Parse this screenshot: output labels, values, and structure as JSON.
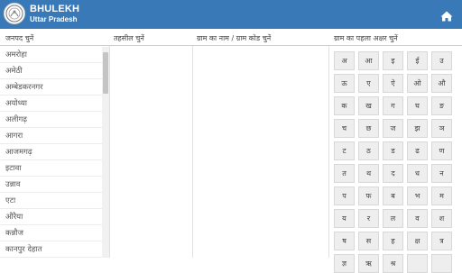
{
  "header": {
    "title": "BHULEKH",
    "subtitle": "Uttar Pradesh",
    "home_icon": "home-icon"
  },
  "columns": {
    "district": "जनपद चुनें",
    "tehsil": "तहसील चुनें",
    "village": "ग्राम का नाम / ग्राम कोड चुनें",
    "letter": "ग्राम का पहला अक्षर चुनें"
  },
  "districts": [
    "अमरोहा",
    "अमेठी",
    "अम्बेडकरनगर",
    "अयोध्या",
    "अलीगढ़",
    "आगरा",
    "आजमगढ़",
    "इटावा",
    "उन्नाव",
    "एटा",
    "औरैया",
    "कन्नौज",
    "कानपुर देहात"
  ],
  "letters": [
    [
      "अ",
      "आ",
      "इ",
      "ई",
      "उ"
    ],
    [
      "ऊ",
      "ए",
      "ऐ",
      "ओ",
      "औ"
    ],
    [
      "क",
      "ख",
      "ग",
      "घ",
      "ङ"
    ],
    [
      "च",
      "छ",
      "ज",
      "झ",
      "ञ"
    ],
    [
      "ट",
      "ठ",
      "ड",
      "ढ",
      "ण"
    ],
    [
      "त",
      "थ",
      "द",
      "ध",
      "न"
    ],
    [
      "प",
      "फ",
      "ब",
      "भ",
      "म"
    ],
    [
      "य",
      "र",
      "ल",
      "व",
      "श"
    ],
    [
      "ष",
      "स",
      "ह",
      "क्ष",
      "त्र"
    ],
    [
      "ज्ञ",
      "ऋ",
      "श्र",
      "",
      ""
    ]
  ]
}
